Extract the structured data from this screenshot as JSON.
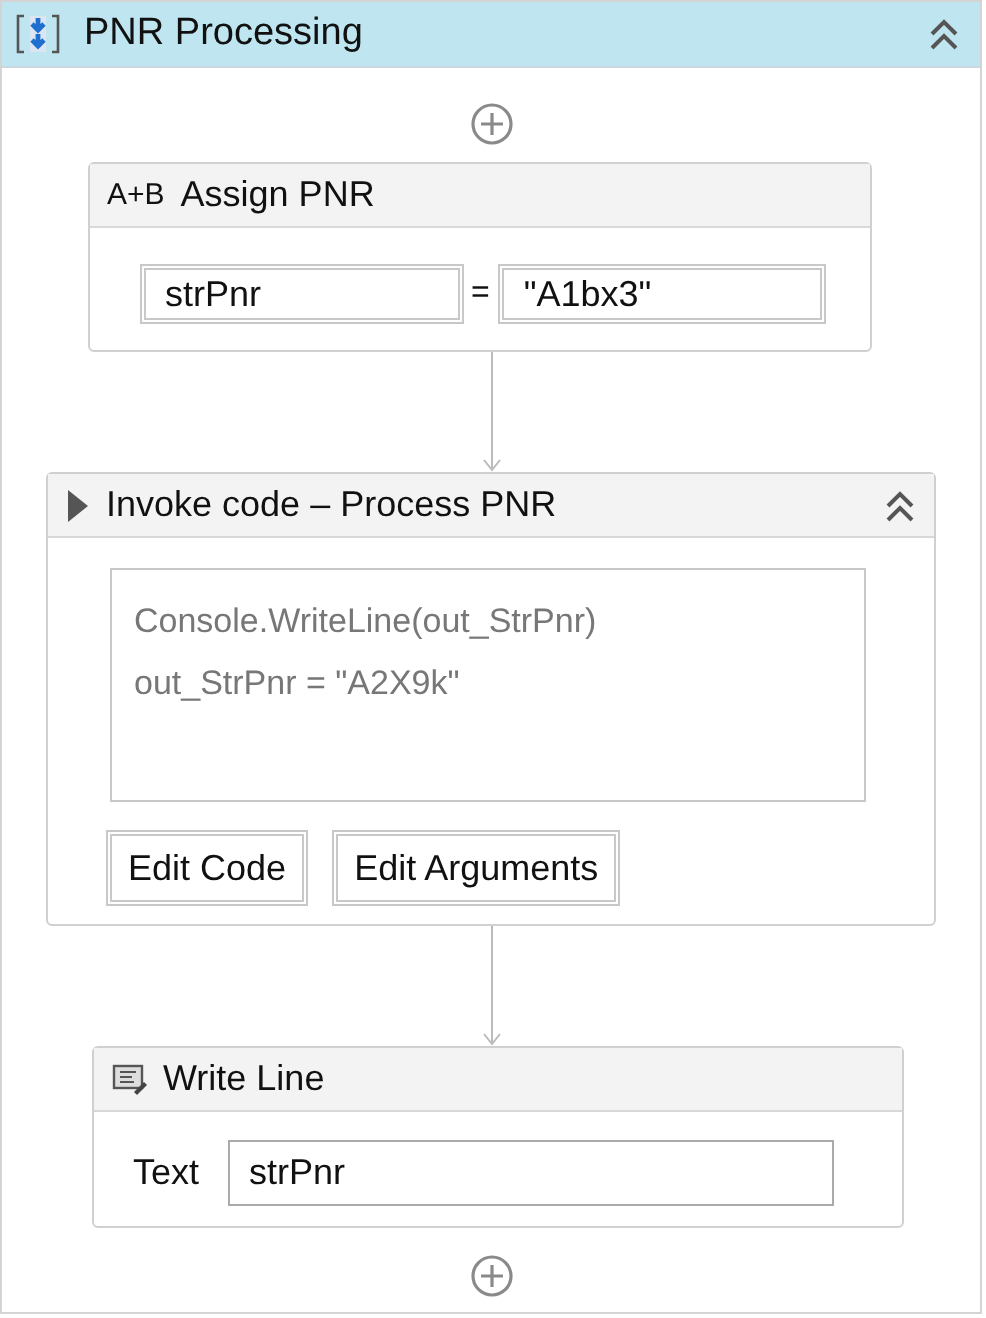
{
  "sequence": {
    "title": "PNR Processing"
  },
  "activities": [
    {
      "kind": "assign",
      "icon_text": "A+B",
      "title": "Assign PNR",
      "to": "strPnr",
      "operator": "=",
      "value": "\"A1bx3\""
    },
    {
      "kind": "invoke_code",
      "title": "Invoke code – Process PNR",
      "code_lines": [
        "Console.WriteLine(out_StrPnr)",
        "out_StrPnr = \"A2X9k\""
      ],
      "buttons": [
        "Edit Code",
        "Edit Arguments"
      ]
    },
    {
      "kind": "write_line",
      "title": "Write Line",
      "field_label": "Text",
      "field_value": "strPnr"
    }
  ]
}
